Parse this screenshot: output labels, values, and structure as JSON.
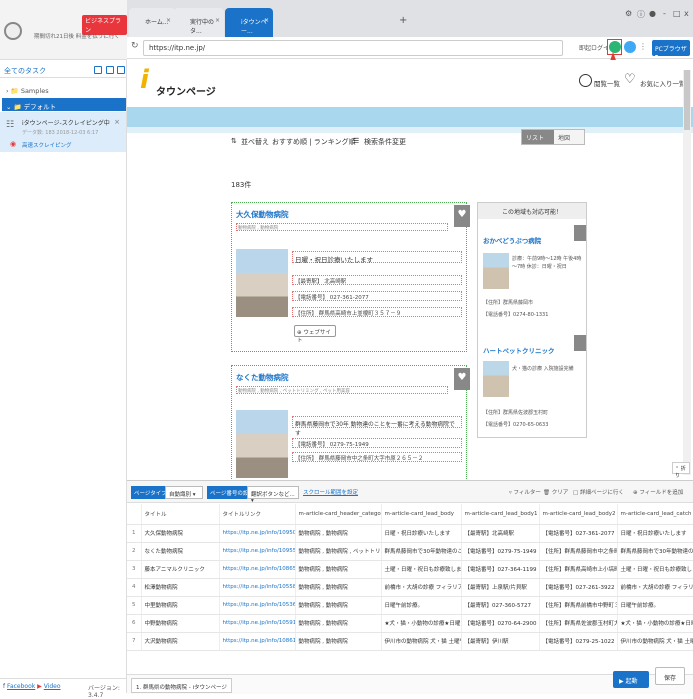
{
  "sidebar": {
    "badge": "ビジネスプラン",
    "trial_text": "期間切れ21日後 料金を払うに行く",
    "all_tasks": "全てのタスク",
    "folders": [
      "Samples",
      "デフォルト"
    ],
    "task": {
      "name": "iタウンページ-スクレイピング中",
      "meta": "データ数: 183   2018-12-03 6:17",
      "status": "高速スクレイピング"
    },
    "footer": {
      "facebook": "Facebook",
      "video": "Video",
      "version": "バージョン: 3.4.7"
    }
  },
  "tabs": [
    {
      "label": "ホーム..."
    },
    {
      "label": "実行中のタ..."
    },
    {
      "label": "iタウンペー..."
    }
  ],
  "window_controls": [
    "-",
    "□",
    "x"
  ],
  "address": {
    "url": "https://itp.ne.jp/",
    "login": "即起ログイン",
    "pc_browser": "PCブラウザ"
  },
  "page": {
    "logo": "タウンページ",
    "logo_mark": "i",
    "history": "閲覧一覧",
    "favorites": "お気に入り一覧",
    "sort": "並べ替え",
    "recommended": "おすすめ順 | ランキング順",
    "search_cond": "検索条件変更",
    "list_btn": "リスト",
    "map_btn": "地図",
    "count": "183件",
    "fold": "折り",
    "cards": [
      {
        "title": "大久保動物病院",
        "category": "動物病院 , 動物病院",
        "headline": "日曜・祝日診療いたします",
        "lines": [
          "【最寄駅】 北高崎駅",
          "【電話番号】 027-361-2077",
          "【住所】 群馬県高崎市上並榎町３５７－９"
        ],
        "web": "ウェブサイト"
      },
      {
        "title": "なくた動物病院",
        "category": "動物病院 , 動物病院 , ペットトリミング , ペット用美容",
        "headline": "群馬県藤岡市で30年 動物達のことを一番に考える動物病院です",
        "lines": [
          "【電話番号】 0279-75-1949",
          "【住所】 群馬県藤岡市中之条町大字市原２６５－２"
        ],
        "web": ""
      }
    ],
    "side": {
      "header": "この地域も対応可能！",
      "items": [
        {
          "name": "おかべどうぶつ病院",
          "text": "診療：午前9時～12時 午後4時～7時 休診：日曜・祝日",
          "lines": [
            "【住所】群馬県藤岡市",
            "【電話番号】0274-80-1331"
          ]
        },
        {
          "name": "ハートペットクリニック",
          "text": "犬・猫の診療 入院施設完備",
          "lines": [
            "【住所】群馬県佐波郡玉村町",
            "【電話番号】0270-65-0633"
          ]
        }
      ]
    }
  },
  "toolbar": {
    "page_type_label": "ページタイプ",
    "page_type": "自動識別",
    "page_num_label": "ページ番号の設定",
    "page_num": "翻訳ボタンなど...",
    "scroll_link": "スクロール範囲を設定",
    "filter": "フィルター",
    "clear": "クリア",
    "goto_page": "詳細ページに行く",
    "add_field": "フィールドを追加"
  },
  "table": {
    "headers": [
      "",
      "タイトル",
      "タイトルリンク",
      "m-article-card_header_category",
      "m-article-card_lead_body",
      "m-article-card_lead_body1",
      "m-article-card_lead_body2",
      "m-article-card_lead_catch"
    ],
    "rows": [
      [
        "1",
        "大久保動物病院",
        "https://itp.ne.jp/info/10950343600...",
        "動物病院 , 動物病院",
        "日曜・祝日診療いたします",
        "【最寄駅】北高崎駅",
        "【電話番号】027-361-2077",
        "日曜・祝日診療いたします"
      ],
      [
        "2",
        "なくた動物病院",
        "https://itp.ne.jp/info/10955429900...",
        "動物病院 , 動物病院 , ペットトリミン...",
        "群馬県藤岡市で30年動物達のことを...",
        "【電話番号】0279-75-1949",
        "【住所】群馬県藤岡市中之条町大字市",
        "群馬県藤岡市で30年動物達のことを..."
      ],
      [
        "3",
        "藤本アニマルクリニック",
        "https://itp.ne.jp/info/10865163900...",
        "動物病院 , 動物病院",
        "土曜・日曜・祝日も診療致します...",
        "【電話番号】027-364-1199",
        "【住所】群馬県高崎市上小塙町４１...",
        "土曜・日曜・祝日も診療致します..."
      ],
      [
        "4",
        "松澤動物病院",
        "https://itp.ne.jp/info/10558252900...",
        "動物病院 , 動物病院",
        "前橋市・大胡の診療 フィラリア予...",
        "【最寄駅】上泉駅/片貝駅",
        "【電話番号】027-261-3922",
        "前橋市・大胡の診療 フィラリア予..."
      ],
      [
        "5",
        "中里動物病院",
        "https://itp.ne.jp/info/10536043600...",
        "動物病院 , 動物病院",
        "日曜午前診療。",
        "【最寄駅】027-360-5727",
        "【住所】群馬県前橋市中野町３丁目...",
        "日曜午前診療。"
      ],
      [
        "6",
        "中野動物病院",
        "https://itp.ne.jp/info/10591949600...",
        "動物病院 , 動物病院",
        "★犬・猫・小動物の診療★日曜・日曜...",
        "【電話番号】0270-64-2900",
        "【住所】群馬県佐波郡玉村町大字福島",
        "★犬・猫・小動物の診療★日曜・日曜..."
      ],
      [
        "7",
        "大沢動物病院",
        "https://itp.ne.jp/info/10861778690...",
        "動物病院 , 動物病院",
        "伊川市の動物病院 犬・猫 土曜午後...",
        "【最寄駅】伊川駅",
        "【電話番号】0279-25-1022",
        "伊川市の動物病院 犬・猫 土曜午後..."
      ]
    ]
  },
  "bottom": {
    "tab": "1. 群馬県の動物病院 - iタウンページ",
    "run": "▶ 起動",
    "save": "保存"
  },
  "colors": {
    "accent": "#1a73c8",
    "badge": "#e8363c",
    "highlight_box": "#e53935",
    "logo": "#f2b300"
  }
}
